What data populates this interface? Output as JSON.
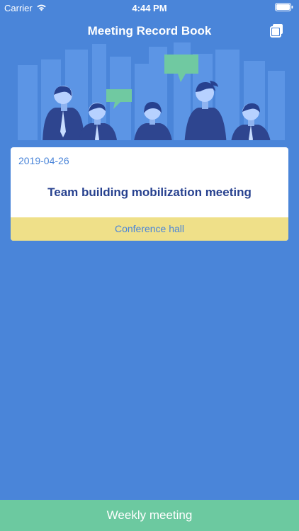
{
  "status_bar": {
    "carrier": "Carrier",
    "time": "4:44 PM",
    "wifi_icon": "wifi-icon",
    "battery_icon": "battery-icon"
  },
  "nav": {
    "title": "Meeting Record Book",
    "copy_icon": "copy-icon"
  },
  "colors": {
    "background": "#4a85d9",
    "card": "#ffffff",
    "title": "#27418f",
    "location_bar": "#efe089",
    "bottom_button": "#6cc9a0",
    "speech_bubble": "#70c9a1"
  },
  "records": [
    {
      "date": "2019-04-26",
      "title": "Team building mobilization meeting",
      "location": "Conference hall"
    }
  ],
  "bottom_button": {
    "label": "Weekly meeting"
  }
}
